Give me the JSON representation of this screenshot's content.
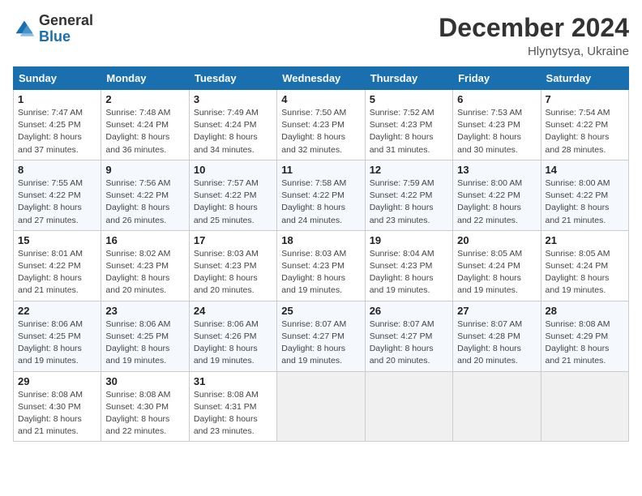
{
  "header": {
    "logo_general": "General",
    "logo_blue": "Blue",
    "month_title": "December 2024",
    "location": "Hlynytsya, Ukraine"
  },
  "weekdays": [
    "Sunday",
    "Monday",
    "Tuesday",
    "Wednesday",
    "Thursday",
    "Friday",
    "Saturday"
  ],
  "weeks": [
    [
      {
        "day": "1",
        "sunrise": "7:47 AM",
        "sunset": "4:25 PM",
        "daylight": "8 hours and 37 minutes."
      },
      {
        "day": "2",
        "sunrise": "7:48 AM",
        "sunset": "4:24 PM",
        "daylight": "8 hours and 36 minutes."
      },
      {
        "day": "3",
        "sunrise": "7:49 AM",
        "sunset": "4:24 PM",
        "daylight": "8 hours and 34 minutes."
      },
      {
        "day": "4",
        "sunrise": "7:50 AM",
        "sunset": "4:23 PM",
        "daylight": "8 hours and 32 minutes."
      },
      {
        "day": "5",
        "sunrise": "7:52 AM",
        "sunset": "4:23 PM",
        "daylight": "8 hours and 31 minutes."
      },
      {
        "day": "6",
        "sunrise": "7:53 AM",
        "sunset": "4:23 PM",
        "daylight": "8 hours and 30 minutes."
      },
      {
        "day": "7",
        "sunrise": "7:54 AM",
        "sunset": "4:22 PM",
        "daylight": "8 hours and 28 minutes."
      }
    ],
    [
      {
        "day": "8",
        "sunrise": "7:55 AM",
        "sunset": "4:22 PM",
        "daylight": "8 hours and 27 minutes."
      },
      {
        "day": "9",
        "sunrise": "7:56 AM",
        "sunset": "4:22 PM",
        "daylight": "8 hours and 26 minutes."
      },
      {
        "day": "10",
        "sunrise": "7:57 AM",
        "sunset": "4:22 PM",
        "daylight": "8 hours and 25 minutes."
      },
      {
        "day": "11",
        "sunrise": "7:58 AM",
        "sunset": "4:22 PM",
        "daylight": "8 hours and 24 minutes."
      },
      {
        "day": "12",
        "sunrise": "7:59 AM",
        "sunset": "4:22 PM",
        "daylight": "8 hours and 23 minutes."
      },
      {
        "day": "13",
        "sunrise": "8:00 AM",
        "sunset": "4:22 PM",
        "daylight": "8 hours and 22 minutes."
      },
      {
        "day": "14",
        "sunrise": "8:00 AM",
        "sunset": "4:22 PM",
        "daylight": "8 hours and 21 minutes."
      }
    ],
    [
      {
        "day": "15",
        "sunrise": "8:01 AM",
        "sunset": "4:22 PM",
        "daylight": "8 hours and 21 minutes."
      },
      {
        "day": "16",
        "sunrise": "8:02 AM",
        "sunset": "4:23 PM",
        "daylight": "8 hours and 20 minutes."
      },
      {
        "day": "17",
        "sunrise": "8:03 AM",
        "sunset": "4:23 PM",
        "daylight": "8 hours and 20 minutes."
      },
      {
        "day": "18",
        "sunrise": "8:03 AM",
        "sunset": "4:23 PM",
        "daylight": "8 hours and 19 minutes."
      },
      {
        "day": "19",
        "sunrise": "8:04 AM",
        "sunset": "4:23 PM",
        "daylight": "8 hours and 19 minutes."
      },
      {
        "day": "20",
        "sunrise": "8:05 AM",
        "sunset": "4:24 PM",
        "daylight": "8 hours and 19 minutes."
      },
      {
        "day": "21",
        "sunrise": "8:05 AM",
        "sunset": "4:24 PM",
        "daylight": "8 hours and 19 minutes."
      }
    ],
    [
      {
        "day": "22",
        "sunrise": "8:06 AM",
        "sunset": "4:25 PM",
        "daylight": "8 hours and 19 minutes."
      },
      {
        "day": "23",
        "sunrise": "8:06 AM",
        "sunset": "4:25 PM",
        "daylight": "8 hours and 19 minutes."
      },
      {
        "day": "24",
        "sunrise": "8:06 AM",
        "sunset": "4:26 PM",
        "daylight": "8 hours and 19 minutes."
      },
      {
        "day": "25",
        "sunrise": "8:07 AM",
        "sunset": "4:27 PM",
        "daylight": "8 hours and 19 minutes."
      },
      {
        "day": "26",
        "sunrise": "8:07 AM",
        "sunset": "4:27 PM",
        "daylight": "8 hours and 20 minutes."
      },
      {
        "day": "27",
        "sunrise": "8:07 AM",
        "sunset": "4:28 PM",
        "daylight": "8 hours and 20 minutes."
      },
      {
        "day": "28",
        "sunrise": "8:08 AM",
        "sunset": "4:29 PM",
        "daylight": "8 hours and 21 minutes."
      }
    ],
    [
      {
        "day": "29",
        "sunrise": "8:08 AM",
        "sunset": "4:30 PM",
        "daylight": "8 hours and 21 minutes."
      },
      {
        "day": "30",
        "sunrise": "8:08 AM",
        "sunset": "4:30 PM",
        "daylight": "8 hours and 22 minutes."
      },
      {
        "day": "31",
        "sunrise": "8:08 AM",
        "sunset": "4:31 PM",
        "daylight": "8 hours and 23 minutes."
      },
      null,
      null,
      null,
      null
    ]
  ]
}
